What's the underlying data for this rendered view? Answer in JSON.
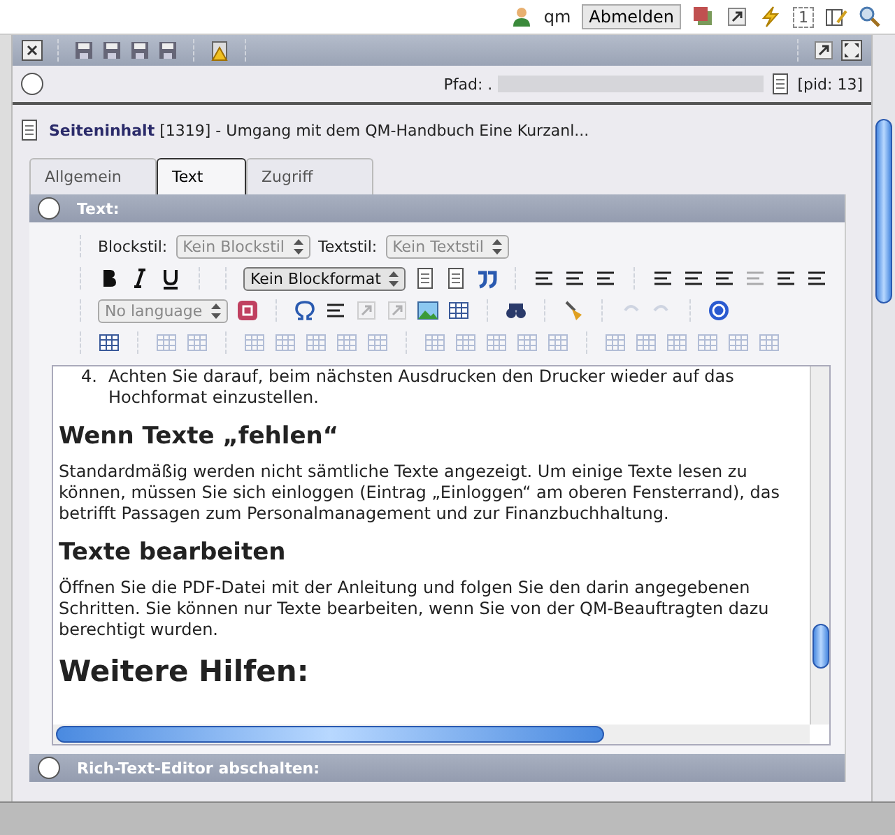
{
  "topbar": {
    "user": "qm",
    "logout": "Abmelden",
    "counter": "1"
  },
  "path": {
    "label": "Pfad: .",
    "pid": "[pid: 13]"
  },
  "record": {
    "type": "Seiteninhalt",
    "id": "[1319]",
    "title": "- Umgang mit dem QM-Handbuch Eine Kurzanl..."
  },
  "tabs": [
    {
      "label": "Allgemein",
      "selected": false
    },
    {
      "label": "Text",
      "selected": true
    },
    {
      "label": "Zugriff",
      "selected": false
    }
  ],
  "text_section": {
    "title": "Text:"
  },
  "editor": {
    "blockstil_label": "Blockstil:",
    "blockstil": "Kein Blockstil",
    "textstil_label": "Textstil:",
    "textstil": "Kein Textstil",
    "blockformat": "Kein Blockformat",
    "language": "No language",
    "content": [
      {
        "kind": "list_item",
        "number": "4.",
        "text": "Achten Sie darauf, beim nächsten Ausdrucken den Drucker wieder auf das Hochformat einzustellen."
      },
      {
        "kind": "h2",
        "text": "Wenn Texte „fehlen“"
      },
      {
        "kind": "p",
        "text": "Standardmäßig werden nicht sämtliche Texte angezeigt. Um einige Texte lesen zu können, müssen Sie sich einloggen (Eintrag „Einloggen“ am oberen Fensterrand), das betrifft Passagen zum Personalmanagement und zur Finanzbuchhaltung."
      },
      {
        "kind": "h2",
        "text": "Texte bearbeiten"
      },
      {
        "kind": "p",
        "text": "Öffnen Sie die PDF-Datei mit der Anleitung und folgen Sie den darin angegebenen Schritten. Sie können nur Texte bearbeiten, wenn Sie von der QM-Beauftragten dazu berechtigt wurden."
      },
      {
        "kind": "h1",
        "text": "Weitere Hilfen:"
      }
    ]
  },
  "rte_section": {
    "title": "Rich-Text-Editor abschalten:"
  }
}
